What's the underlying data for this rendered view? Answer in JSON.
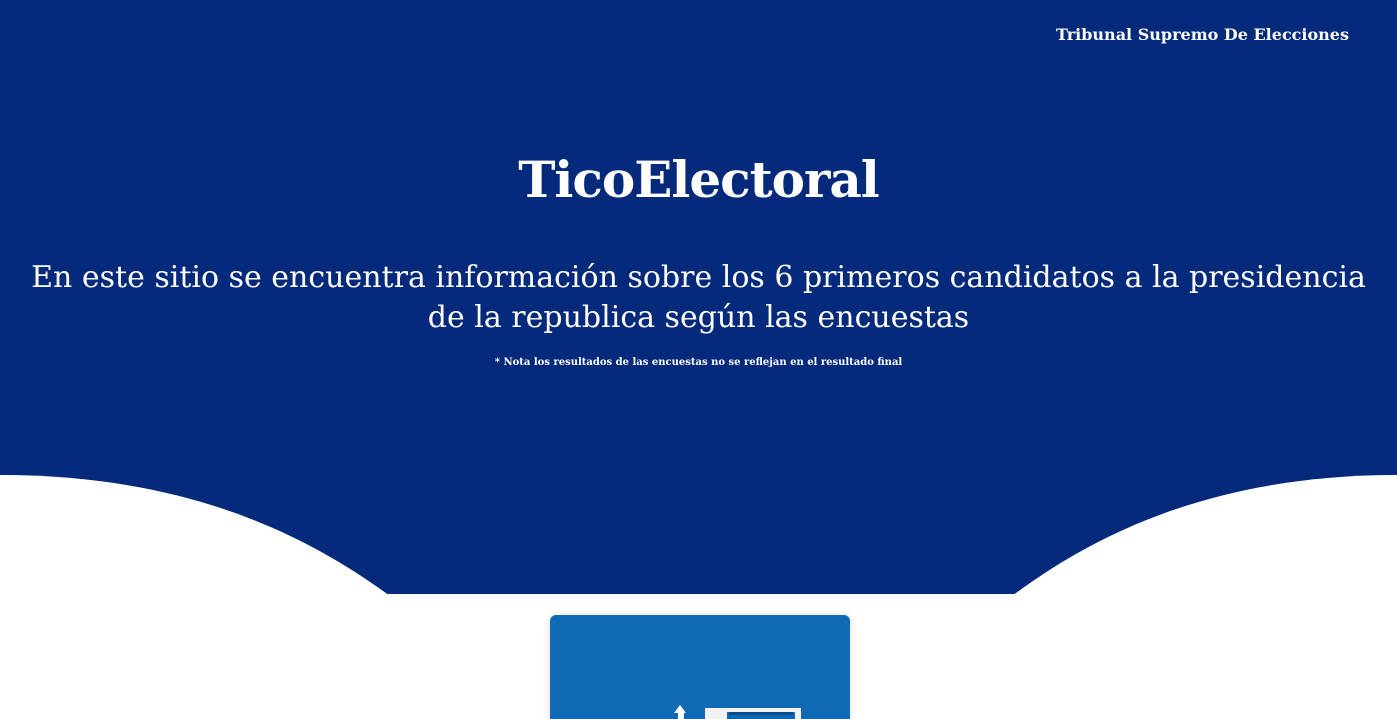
{
  "header": {
    "nav_link": "Tribunal Supremo De Elecciones"
  },
  "hero": {
    "title": "TicoElectoral",
    "headline": "En este sitio se encuentra información sobre los 6 primeros candidatos a la presidencia de la republica según las encuestas",
    "note": "* Nota los resultados de las encuestas no se reflejan en el resultado final"
  },
  "card": {
    "icon": "ballot-box-icon"
  },
  "colors": {
    "hero_background": "#052a7c",
    "card_background": "#0f69b4",
    "page_background": "#ffffff"
  }
}
